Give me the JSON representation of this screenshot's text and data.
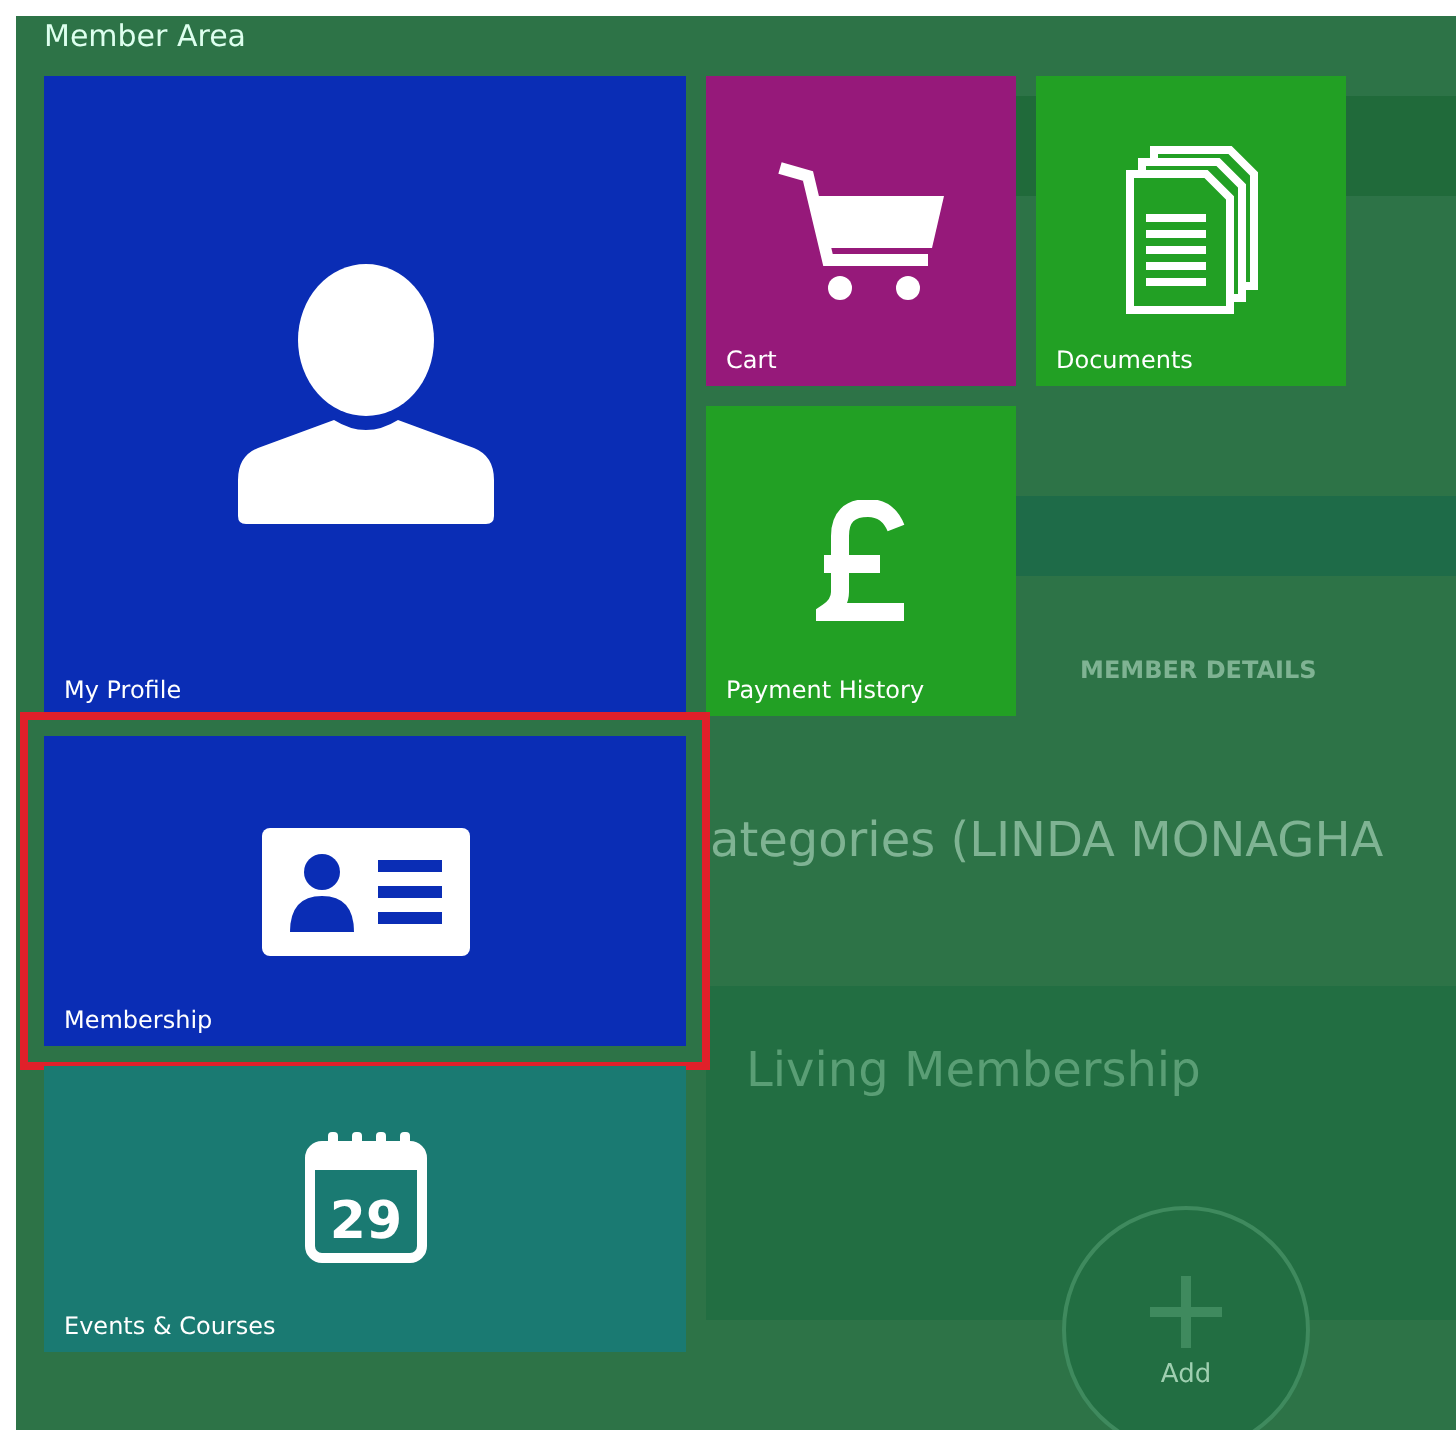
{
  "panel": {
    "title": "Member Area"
  },
  "tiles": [
    {
      "label": "My Profile",
      "kind": "profile",
      "color": "#0a2db5",
      "highlighted": false
    },
    {
      "label": "Cart",
      "kind": "cart",
      "color": "#96197a",
      "highlighted": false
    },
    {
      "label": "Documents",
      "kind": "documents",
      "color": "#22a024",
      "highlighted": false
    },
    {
      "label": "Payment History",
      "kind": "pound",
      "color": "#22a024",
      "highlighted": false
    },
    {
      "label": "Membership",
      "kind": "card",
      "color": "#0a2db5",
      "highlighted": true
    },
    {
      "label": "Events & Courses",
      "kind": "calendar",
      "color": "#1a7a72",
      "highlighted": false,
      "day": "29"
    }
  ],
  "background_page": {
    "tab": "MEMBER DETAILS",
    "heading": "ategories (LINDA MONAGHA",
    "card_title": "Living Membership",
    "add_button": "Add"
  }
}
